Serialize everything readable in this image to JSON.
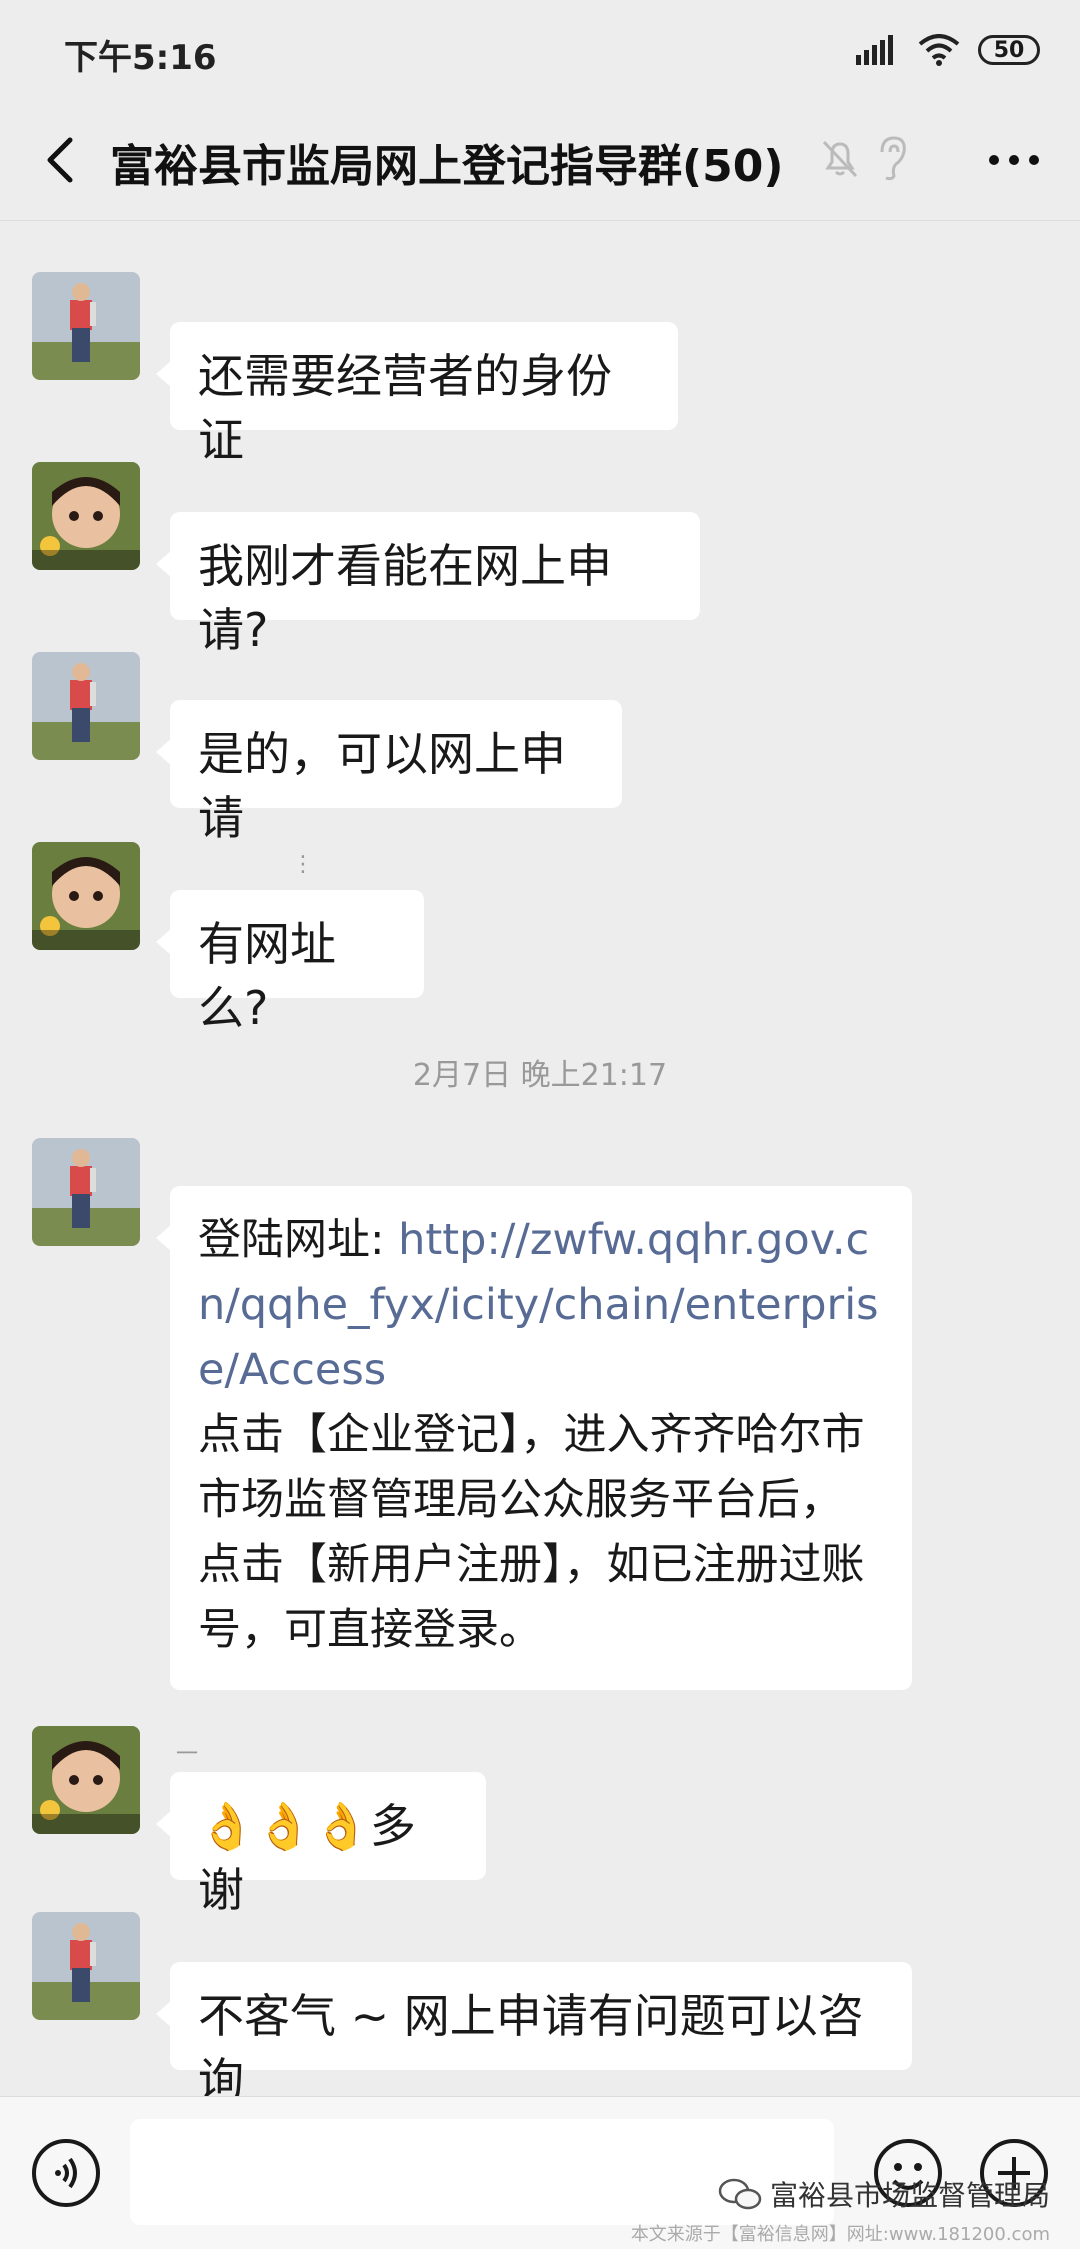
{
  "status_bar": {
    "time": "下午5:16",
    "battery": "50"
  },
  "header": {
    "title": "富裕县市监局网上登记指导群(50)"
  },
  "messages": [
    {
      "sender": "official",
      "nickname": "",
      "text": "还需要经营者的身份证"
    },
    {
      "sender": "user",
      "nickname": "",
      "text": "我刚才看能在网上申请?"
    },
    {
      "sender": "official",
      "nickname": "",
      "text": "是的，可以网上申请"
    },
    {
      "sender": "user",
      "nickname": "⋮",
      "text": "有网址么?"
    },
    {
      "sender": "official",
      "nickname": "",
      "prefix": "登陆网址: ",
      "link": "http://zwfw.qqhr.gov.cn/qqhe_fyx/icity/chain/enterprise/Access",
      "text": "点击【企业登记】，进入齐齐哈尔市市场监督管理局公众服务平台后，点击【新用户注册】，如已注册过账号，可直接登录。"
    },
    {
      "sender": "user",
      "nickname": "一",
      "emoji": "👌👌👌",
      "text": "多谢"
    },
    {
      "sender": "official",
      "nickname": "",
      "text": "不客气 ~ 网上申请有问题可以咨询"
    }
  ],
  "timestamp": "2月7日 晚上21:17",
  "input_bar": {
    "placeholder": ""
  },
  "watermark": {
    "account": "富裕县市场监督管理局",
    "source": "本文来源于【富裕信息网】网址:www.181200.com"
  },
  "colors": {
    "background": "#ededed",
    "bubble": "#ffffff",
    "link": "#576b95"
  }
}
